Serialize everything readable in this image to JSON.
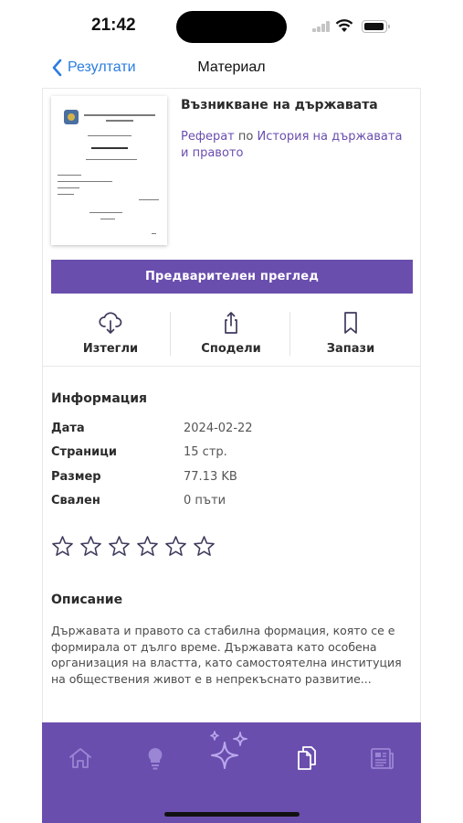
{
  "status_bar": {
    "time": "21:42"
  },
  "nav": {
    "back_label": "Резултати",
    "title": "Материал"
  },
  "document": {
    "title": "Възникване на държавата",
    "type": "Реферат",
    "by_word": "по",
    "subject": "История на държавата и правото"
  },
  "preview_button": "Предварителен преглед",
  "actions": {
    "download": "Изтегли",
    "share": "Сподели",
    "save": "Запази"
  },
  "info": {
    "heading": "Информация",
    "rows": [
      {
        "label": "Дата",
        "value": "2024-02-22"
      },
      {
        "label": "Страници",
        "value": "15 стр."
      },
      {
        "label": "Размер",
        "value": "77.13 KB"
      },
      {
        "label": "Свален",
        "value": "0 пъти"
      }
    ]
  },
  "rating": {
    "value": 0,
    "max": 6
  },
  "description": {
    "heading": "Описание",
    "text": "Държавата и правото са стабилна формация, която се е формирала от дълго време. Държавата като особена организация на властта, като самостоятелна институция на обществения живот е в непрекъснато развитие..."
  },
  "tabbar": {
    "tabs": [
      "home-icon",
      "lightbulb-icon",
      "sparkles-icon",
      "documents-icon",
      "newspaper-icon"
    ],
    "active": "documents-icon"
  },
  "colors": {
    "accent": "#6a4eae",
    "link": "#2a7de1"
  }
}
